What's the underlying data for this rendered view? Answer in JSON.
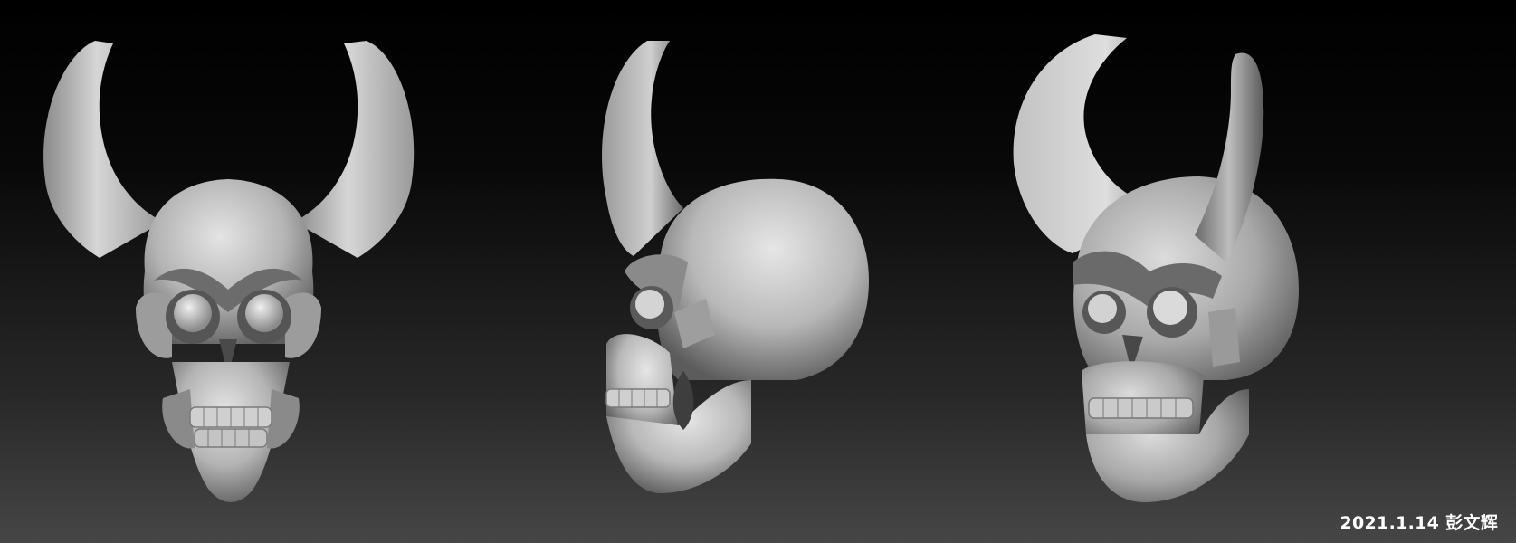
{
  "caption": "2021.1.14 彭文辉",
  "palette": {
    "background_top": "#000000",
    "background_bottom": "#464646",
    "clay_light": "#d8d8d8",
    "clay_mid": "#a8a8a8",
    "clay_dark": "#5a5a5a",
    "caption_color": "#ffffff"
  },
  "views": [
    {
      "name": "front-view",
      "icon": "horned-skull-front-icon"
    },
    {
      "name": "side-view",
      "icon": "horned-skull-side-icon"
    },
    {
      "name": "three-quarter-view",
      "icon": "horned-skull-three-quarter-icon"
    }
  ]
}
